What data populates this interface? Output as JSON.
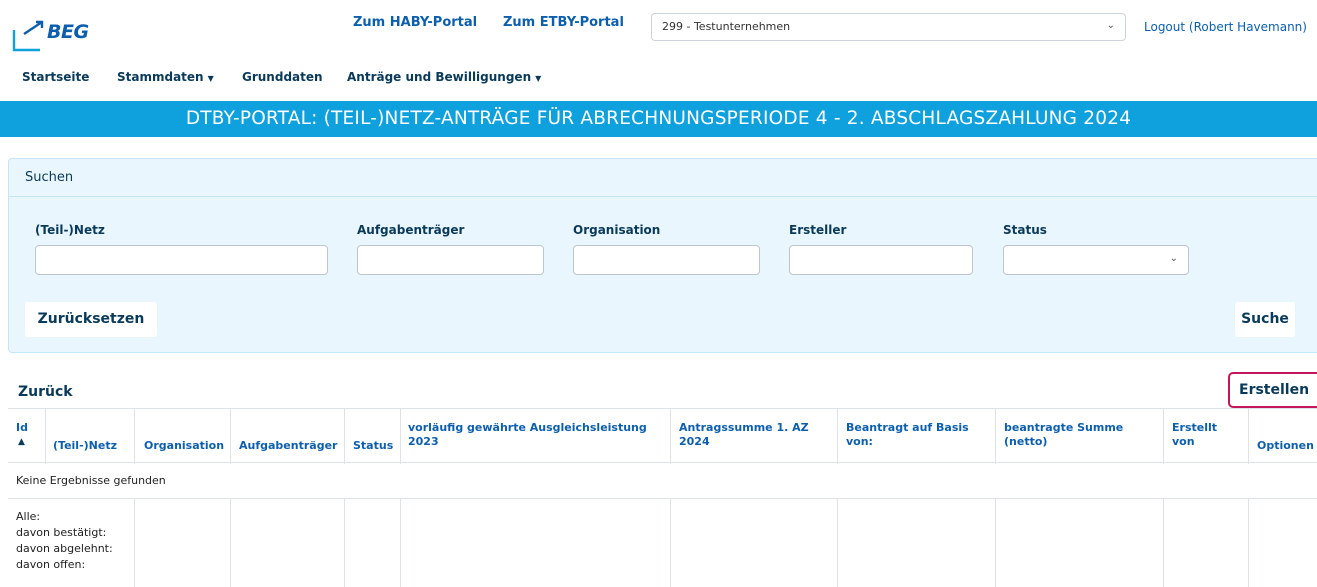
{
  "header": {
    "logo_text": "BEG",
    "links": [
      "Zum HABY-Portal",
      "Zum ETBY-Portal"
    ],
    "org_select_value": "299 - Testunternehmen",
    "logout_label": "Logout (Robert Havemann)"
  },
  "nav": {
    "items": [
      {
        "label": "Startseite",
        "dropdown": false
      },
      {
        "label": "Stammdaten",
        "dropdown": true
      },
      {
        "label": "Grunddaten",
        "dropdown": false
      },
      {
        "label": "Anträge und Bewilligungen",
        "dropdown": true
      }
    ]
  },
  "banner": {
    "title": "DTBY-PORTAL: (TEIL-)NETZ-ANTRÄGE FÜR ABRECHNUNGSPERIODE 4 - 2. ABSCHLAGSZAHLUNG 2024"
  },
  "search": {
    "panel_title": "Suchen",
    "fields": [
      {
        "label": "(Teil-)Netz",
        "value": ""
      },
      {
        "label": "Aufgabenträger",
        "value": ""
      },
      {
        "label": "Organisation",
        "value": ""
      },
      {
        "label": "Ersteller",
        "value": ""
      },
      {
        "label": "Status",
        "value": ""
      }
    ],
    "reset_label": "Zurücksetzen",
    "search_label": "Suche"
  },
  "actions": {
    "back_label": "Zurück",
    "create_label": "Erstellen"
  },
  "table": {
    "columns": [
      "Id",
      "(Teil-)Netz",
      "Organisation",
      "Aufgabenträger",
      "Status",
      "vorläufig gewährte Ausgleichsleistung 2023",
      "Antragssumme 1. AZ 2024",
      "Beantragt auf Basis von:",
      "beantragte Summe (netto)",
      "Erstellt von",
      "Optionen"
    ],
    "empty_message": "Keine Ergebnisse gefunden",
    "summary_labels": [
      "Alle:",
      "davon bestätigt:",
      "davon abgelehnt:",
      "davon offen:"
    ]
  },
  "colors": {
    "banner": "#0fa0de",
    "panel_bg": "#eaf6fd",
    "link": "#0d5fae",
    "text": "#0a3a5a",
    "create_border": "#c2185b"
  },
  "icons": [
    "beg-logo-icon",
    "chevron-down-icon",
    "caret-down-icon",
    "sort-ascending-icon"
  ]
}
